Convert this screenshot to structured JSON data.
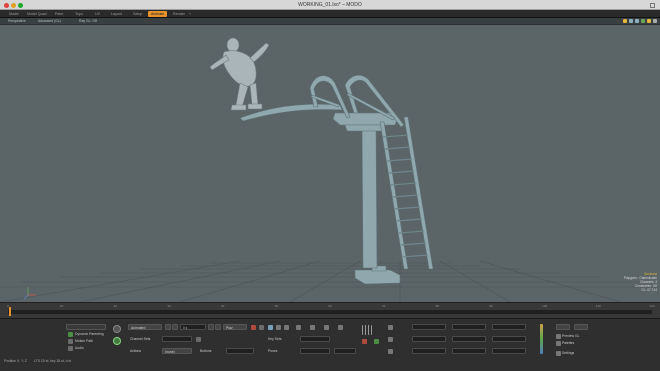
{
  "window": {
    "title": "WORKING_01.lxo* – MODO"
  },
  "tabs": [
    "Model",
    "Model Quad",
    "Paint",
    "Topo",
    "UV",
    "Layout",
    "Setup",
    "Animate",
    "Render",
    "+"
  ],
  "active_tab": "Animate",
  "viewport": {
    "view_mode": "Perspective",
    "shading": "Advanced (GL)",
    "overlay": "Ray GL: Off",
    "info": {
      "item": "Sunburst",
      "polygons": "Polygons : Catmullclark",
      "channels": "Channels: 3",
      "constraints": "Constraints: Off",
      "gl": "GL: 67,744"
    }
  },
  "timeline": {
    "ticks": [
      "0",
      "10",
      "20",
      "30",
      "40",
      "50",
      "60",
      "70",
      "80",
      "90",
      "100",
      "110",
      "120"
    ]
  },
  "panel": {
    "dynamic_parenting": "Dynamic Parenting",
    "motion_path": "Motion Path",
    "audio": "Audio",
    "animated": "Animated",
    "play": "Play",
    "key_sets": "Key Sets",
    "channel_sets": "Channel Sets",
    "actions": "Actions",
    "actions_value": "(none)",
    "buttons": "Buttons",
    "poses": "Poses",
    "preview_gl": "Preview GL",
    "palettes": "Palettes",
    "settings": "Settings",
    "time": "0 s",
    "status_position": "Position X, Y, Z",
    "status_hint": "LTS 15 st: key 18 st, d st"
  },
  "colors": {
    "accent": "#e4912e",
    "viewport_bg": "#5b6467",
    "model": "#8fa7ad"
  }
}
